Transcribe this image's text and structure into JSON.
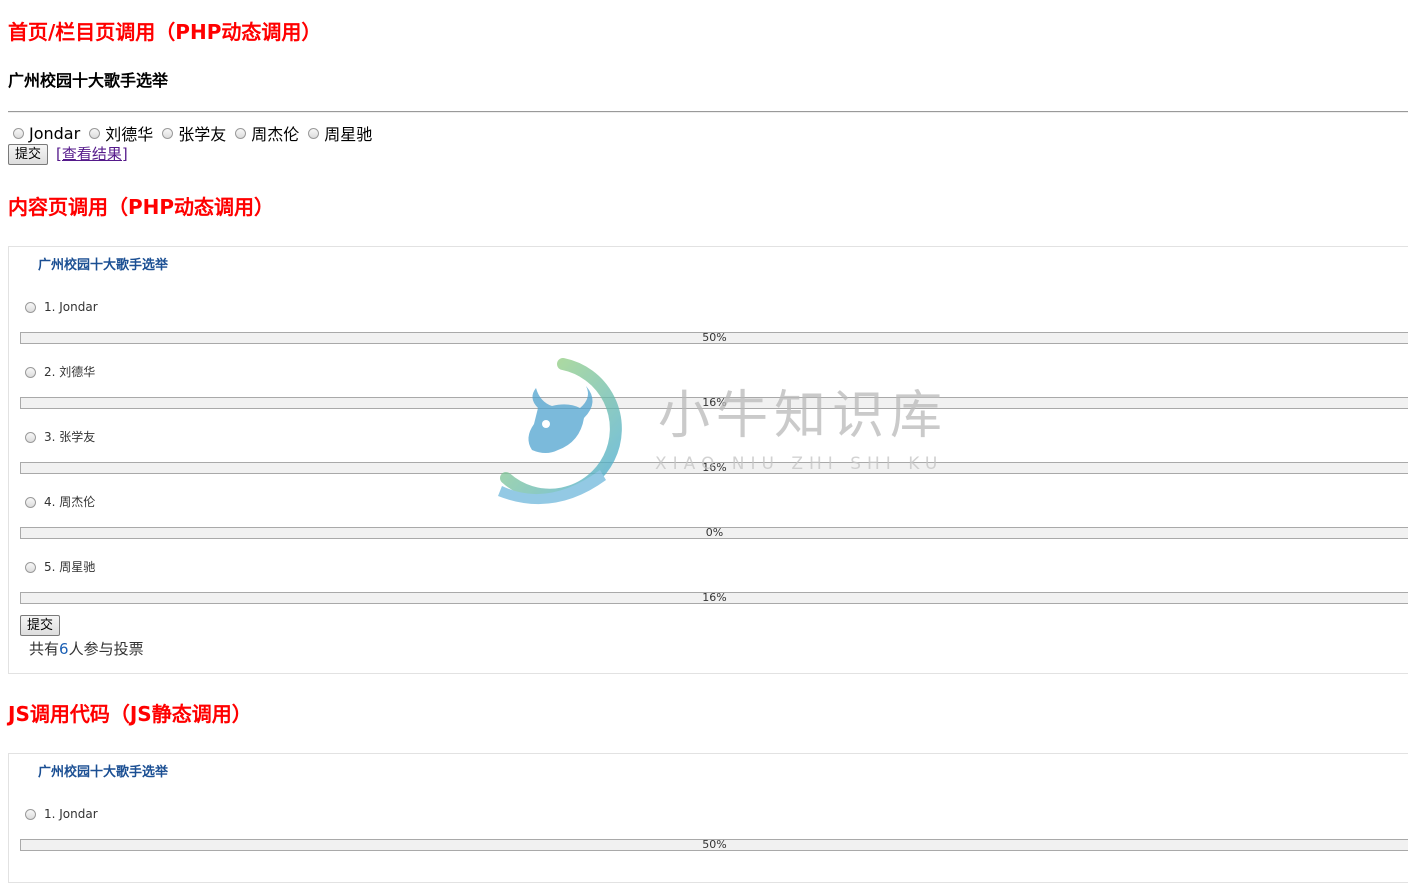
{
  "sections": {
    "home_heading": "首页/栏目页调用（PHP动态调用）",
    "content_heading": "内容页调用（PHP动态调用）",
    "js_heading": "JS调用代码（JS静态调用）"
  },
  "simple_poll": {
    "title": "广州校园十大歌手选举",
    "options": [
      "Jondar",
      "刘德华",
      "张学友",
      "周杰伦",
      "周星驰"
    ],
    "submit_label": "提交",
    "results_link": "[查看结果]"
  },
  "content_poll": {
    "title": "广州校园十大歌手选举",
    "items": [
      {
        "label": "1. Jondar",
        "percent": "50%",
        "fraction": 0.5
      },
      {
        "label": "2. 刘德华",
        "percent": "16%",
        "fraction": 0.16
      },
      {
        "label": "3. 张学友",
        "percent": "16%",
        "fraction": 0.16
      },
      {
        "label": "4. 周杰伦",
        "percent": "0%",
        "fraction": 0.0
      },
      {
        "label": "5. 周星驰",
        "percent": "16%",
        "fraction": 0.16
      }
    ],
    "submit_label": "提交",
    "total_prefix": "共有",
    "total_count": "6",
    "total_suffix": "人参与投票"
  },
  "js_poll": {
    "title": "广州校园十大歌手选举",
    "items": [
      {
        "label": "1. Jondar",
        "percent": "50%",
        "fraction": 0.5
      }
    ]
  },
  "watermark": {
    "text_cn": "小牛知识库",
    "text_en": "XIAO NIU ZHI SHI KU",
    "colors": {
      "ring_start": "#a8d86a",
      "ring_end": "#3fa7d6",
      "text": "#b9b9b9"
    }
  }
}
